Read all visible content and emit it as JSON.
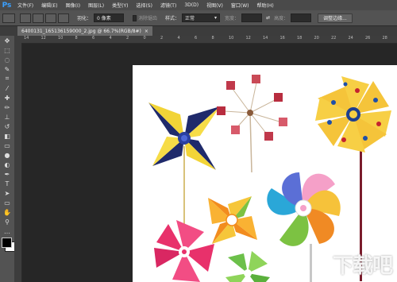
{
  "app": {
    "logo": "Ps"
  },
  "menu": [
    "文件(F)",
    "编辑(E)",
    "图像(I)",
    "图层(L)",
    "类型(Y)",
    "选择(S)",
    "滤镜(T)",
    "3D(D)",
    "视图(V)",
    "窗口(W)",
    "帮助(H)"
  ],
  "options": {
    "feather_label": "羽化：",
    "feather_value": "0 像素",
    "antialias_label": "消除锯齿",
    "style_label": "样式：",
    "style_value": "正常",
    "width_label": "宽度：",
    "height_label": "高度：",
    "refine_button": "调整边缘..."
  },
  "document": {
    "tab_title": "6400131_165136159000_2.jpg @ 66.7%(RGB/8#)"
  },
  "ruler": {
    "top": [
      "14",
      "12",
      "10",
      "8",
      "6",
      "4",
      "2",
      "0",
      "2",
      "4",
      "6",
      "8",
      "10",
      "12",
      "14",
      "16",
      "18",
      "20",
      "22",
      "24",
      "26",
      "28"
    ]
  },
  "watermark": "下载吧",
  "colors": {
    "foreground": "#000000",
    "background": "#ffffff",
    "accent": "#3aa0ff"
  }
}
